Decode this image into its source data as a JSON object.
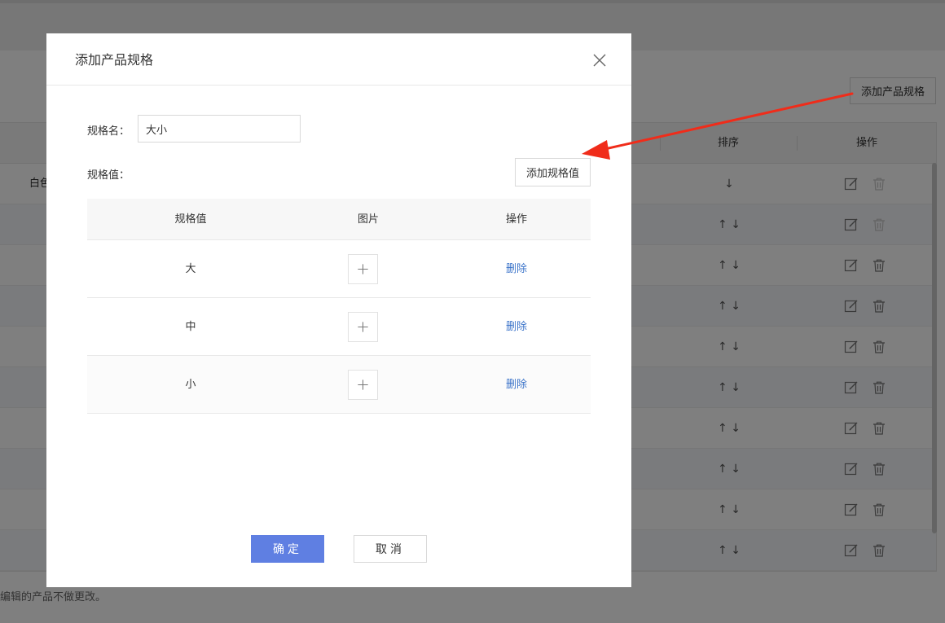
{
  "background": {
    "add_spec_button": "添加产品规格",
    "columns": {
      "sort": "排序",
      "actions": "操作"
    },
    "first_row_text": "白色",
    "rows": [
      {
        "sort": "↓"
      },
      {
        "sort": "↑ ↓"
      },
      {
        "sort": "↑ ↓"
      },
      {
        "sort": "↑ ↓"
      },
      {
        "sort": "↑ ↓"
      },
      {
        "sort": "↑ ↓"
      },
      {
        "sort": "↑ ↓"
      },
      {
        "sort": "↑ ↓"
      },
      {
        "sort": "↑ ↓"
      },
      {
        "sort": "↑ ↓"
      }
    ],
    "footer_note": "编辑的产品不做更改。"
  },
  "modal": {
    "title": "添加产品规格",
    "name_label": "规格名：",
    "name_value": "大小",
    "values_label": "规格值：",
    "add_value_button": "添加规格值",
    "table": {
      "headers": [
        "规格值",
        "图片",
        "操作"
      ],
      "rows": [
        {
          "value": "大",
          "action": "删除"
        },
        {
          "value": "中",
          "action": "删除"
        },
        {
          "value": "小",
          "action": "删除"
        }
      ]
    },
    "ok_button": "确定",
    "cancel_button": "取消"
  },
  "annotation": {
    "arrow_color": "#f02c1a"
  }
}
